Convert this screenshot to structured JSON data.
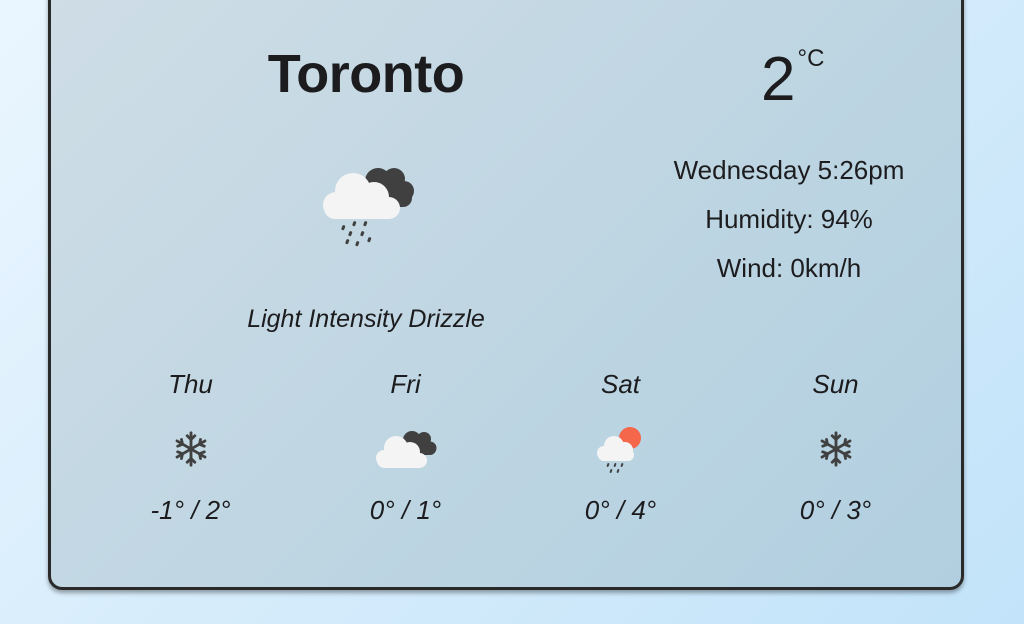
{
  "city": "Toronto",
  "current": {
    "temperature": "2",
    "unit": "°C",
    "description": "Light Intensity Drizzle",
    "icon": "drizzle-cloud-icon"
  },
  "details": {
    "datetime": "Wednesday 5:26pm",
    "humidity": "Humidity: 94%",
    "wind": "Wind: 0km/h"
  },
  "forecast": [
    {
      "day": "Thu",
      "temps": "-1° / 2°",
      "icon": "snowflake-icon"
    },
    {
      "day": "Fri",
      "temps": "0° / 1°",
      "icon": "cloudy-icon"
    },
    {
      "day": "Sat",
      "temps": "0° / 4°",
      "icon": "sun-cloud-rain-icon"
    },
    {
      "day": "Sun",
      "temps": "0° / 3°",
      "icon": "snowflake-icon"
    }
  ],
  "colors": {
    "card_border": "#2a2a2a",
    "text": "#1c1c1e",
    "sun": "#f4674a",
    "dark_cloud": "#404040",
    "light_cloud": "#f4f4f4"
  }
}
